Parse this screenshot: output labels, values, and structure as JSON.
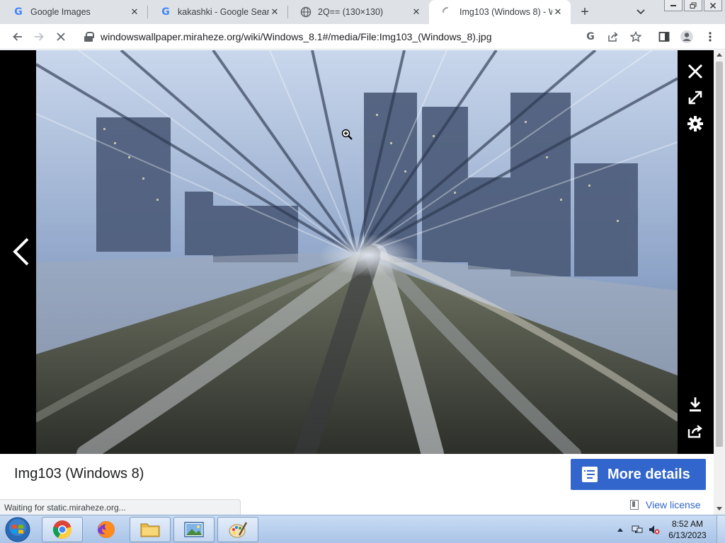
{
  "browser": {
    "tabs": [
      {
        "title": "Google Images",
        "icon": "google-icon",
        "active": false
      },
      {
        "title": "kakashki - Google Search",
        "icon": "google-icon",
        "active": false
      },
      {
        "title": "2Q== (130×130)",
        "icon": "globe-icon",
        "active": false
      },
      {
        "title": "Img103 (Windows 8) - W",
        "icon": "loading-spinner-icon",
        "active": true
      }
    ],
    "close_glyph": "✕",
    "new_tab_glyph": "+",
    "url": "windowswallpaper.miraheze.org/wiki/Windows_8.1#/media/File:Img103_(Windows_8).jpg"
  },
  "viewer": {
    "title": "Img103 (Windows 8)",
    "more_details_label": "More details",
    "license_label": "View license",
    "status_text": "Waiting for static.miraheze.org...",
    "colors": {
      "button": "#3366cc",
      "link": "#3366cc",
      "backdrop": "#000000"
    }
  },
  "taskbar": {
    "time": "8:52 AM",
    "date": "6/13/2023",
    "apps": [
      "chrome-icon",
      "firefox-icon",
      "file-explorer-icon",
      "photo-viewer-icon",
      "paint-icon"
    ]
  }
}
